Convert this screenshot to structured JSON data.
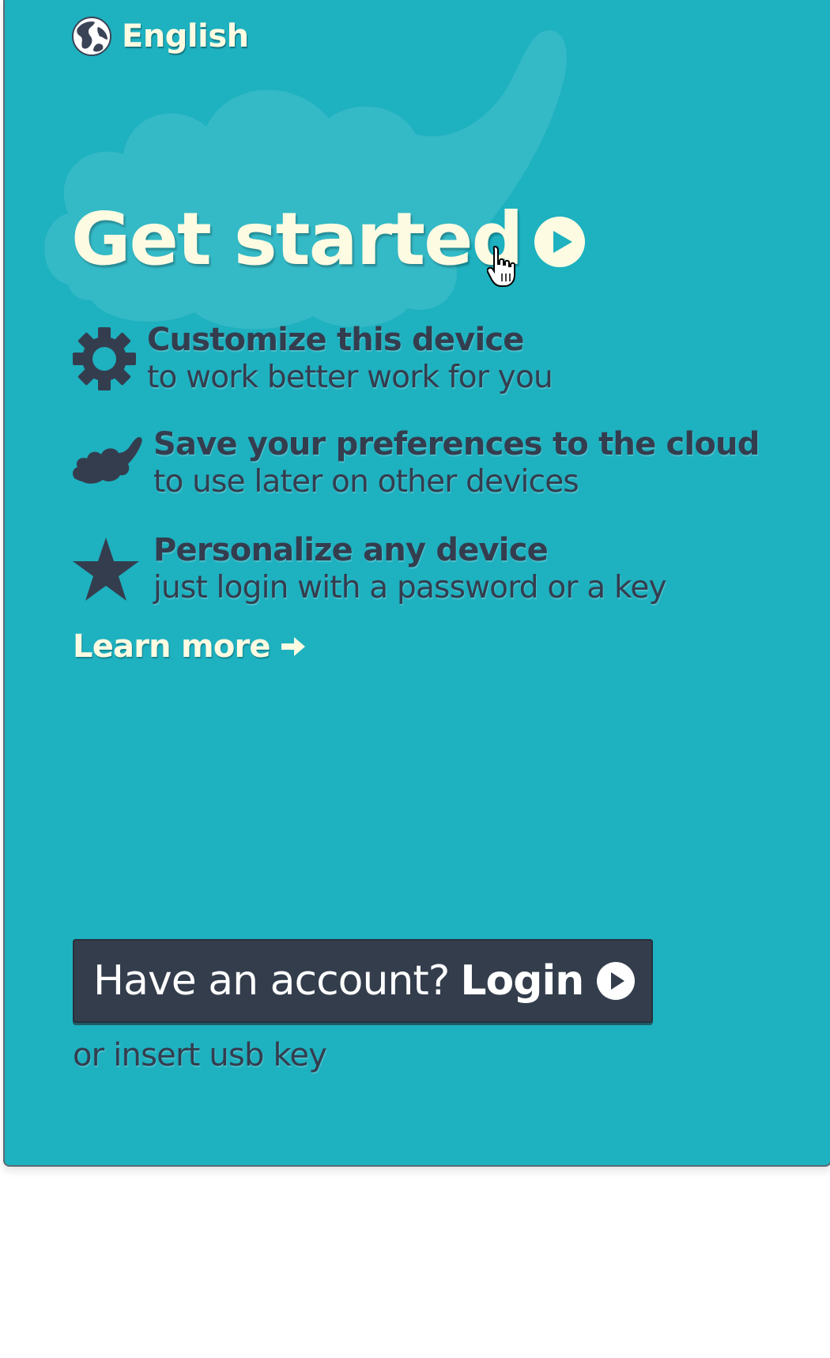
{
  "language": {
    "label": "English",
    "icon": "globe-icon"
  },
  "get_started": {
    "label": "Get started",
    "icon": "play-circle-icon"
  },
  "features": [
    {
      "icon": "gear-icon",
      "title": "Customize this device",
      "subtitle": "to work better work for you"
    },
    {
      "icon": "cloud-icon",
      "title": "Save your preferences to the cloud",
      "subtitle": "to use later on other devices"
    },
    {
      "icon": "star-icon",
      "title": "Personalize any device",
      "subtitle": "just login with a password or a key"
    }
  ],
  "learn_more": {
    "label": "Learn more",
    "icon": "arrow-right-icon"
  },
  "login": {
    "prefix": "Have an account?",
    "action": "Login",
    "icon": "play-circle-icon"
  },
  "usb_hint": "or insert usb key",
  "colors": {
    "panel_bg": "#1eb1c0",
    "heading_text": "#fdfbe2",
    "body_text": "#343d4e",
    "button_bg": "#333d4c",
    "button_text": "#ffffff"
  }
}
